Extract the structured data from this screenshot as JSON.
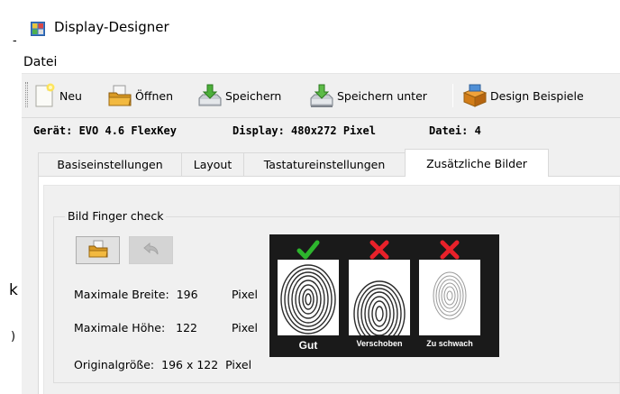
{
  "outside": {
    "char_top": "-",
    "char_mid": "k",
    "char_bot": ")"
  },
  "window": {
    "title": "Display-Designer",
    "icon": "app-grid-icon"
  },
  "menu": {
    "items": [
      {
        "label": "Datei"
      }
    ]
  },
  "toolbar": {
    "buttons": [
      {
        "label": "Neu",
        "icon": "new-file-icon"
      },
      {
        "label": "Öffnen",
        "icon": "open-folder-icon"
      },
      {
        "label": "Speichern",
        "icon": "save-disk-icon"
      },
      {
        "label": "Speichern unter",
        "icon": "save-as-disk-icon"
      },
      {
        "label": "Design Beispiele",
        "icon": "design-examples-box-icon"
      }
    ]
  },
  "info": {
    "device": "Gerät: EVO 4.6 FlexKey",
    "display": "Display: 480x272 Pixel",
    "file": "Datei: 4"
  },
  "tabs": [
    {
      "label": "Basiseinstellungen",
      "active": false
    },
    {
      "label": "Layout",
      "active": false
    },
    {
      "label": "Tastatureinstellungen",
      "active": false
    },
    {
      "label": "Zusätzliche Bilder",
      "active": true
    }
  ],
  "group": {
    "title": "Bild Finger check",
    "open_button_icon": "open-folder-icon",
    "undo_button_icon": "undo-arrow-icon",
    "rows": [
      {
        "label": "Maximale Breite:",
        "value": "196",
        "unit": "Pixel"
      },
      {
        "label": "Maximale Höhe:",
        "value": "122",
        "unit": "Pixel"
      },
      {
        "label": "Originalgröße:",
        "value": "196 x 122",
        "unit": "Pixel"
      }
    ]
  },
  "preview": {
    "items": [
      {
        "caption": "Gut",
        "status_icon": "green-checkmark-icon",
        "status_color": "#2db52d"
      },
      {
        "caption": "Verschoben",
        "status_icon": "red-cross-icon",
        "status_color": "#e8212a"
      },
      {
        "caption": "Zu schwach",
        "status_icon": "red-cross-icon",
        "status_color": "#e8212a"
      }
    ]
  }
}
